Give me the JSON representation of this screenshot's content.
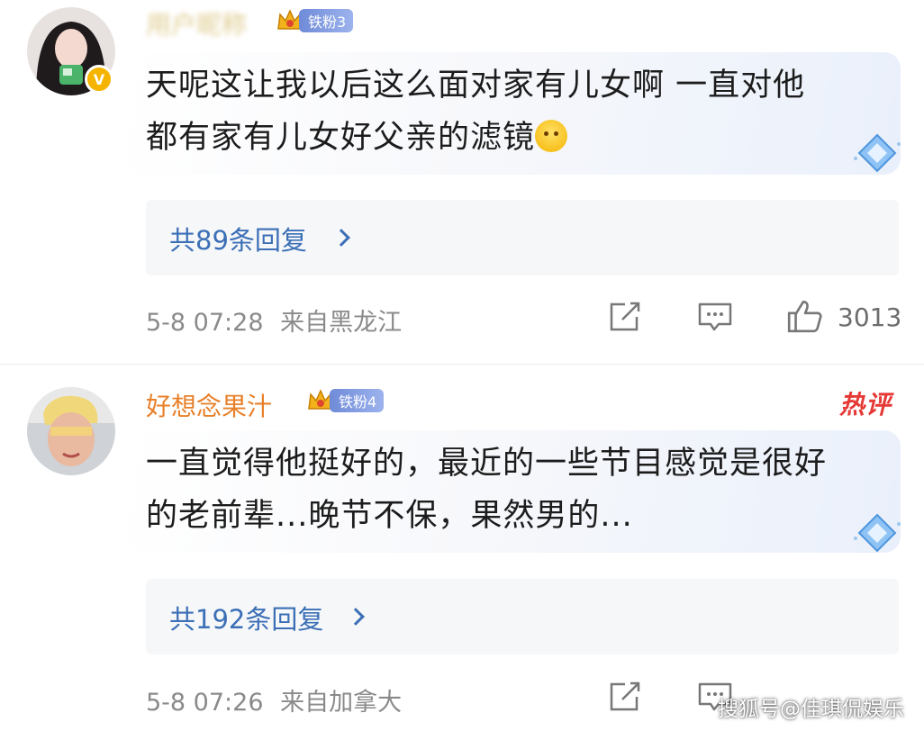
{
  "comments": [
    {
      "username": "用户昵称",
      "fan_badge": "铁粉3",
      "text_line1": "天呢这让我以后这么面对家有儿女啊 一直对他",
      "text_line2": "都有家有儿女好父亲的滤镜",
      "emoji_icon": "crying-face-emoji",
      "verified": true,
      "replies_label": "共89条回复",
      "date": "5-8 07:28",
      "location": "来自黑龙江",
      "likes": "3013"
    },
    {
      "username": "好想念果汁",
      "fan_badge": "铁粉4",
      "hot_badge": "热评",
      "text_line1": "一直觉得他挺好的，最近的一些节目感觉是很好",
      "text_line2": "的老前辈...晚节不保，果然男的...",
      "replies_label": "共192条回复",
      "date": "5-8 07:26",
      "location": "来自加拿大"
    }
  ],
  "watermark": "搜狐号@佳琪侃娱乐",
  "colors": {
    "username": "#e8802a",
    "link": "#3b6fb6",
    "meta": "#8a8a8a",
    "hot": "#e53935",
    "badge": "#7f98df"
  },
  "icons": [
    "share-icon",
    "comment-icon",
    "thumbs-up-icon",
    "chevron-right-icon",
    "crown-icon",
    "diamond-icon"
  ]
}
